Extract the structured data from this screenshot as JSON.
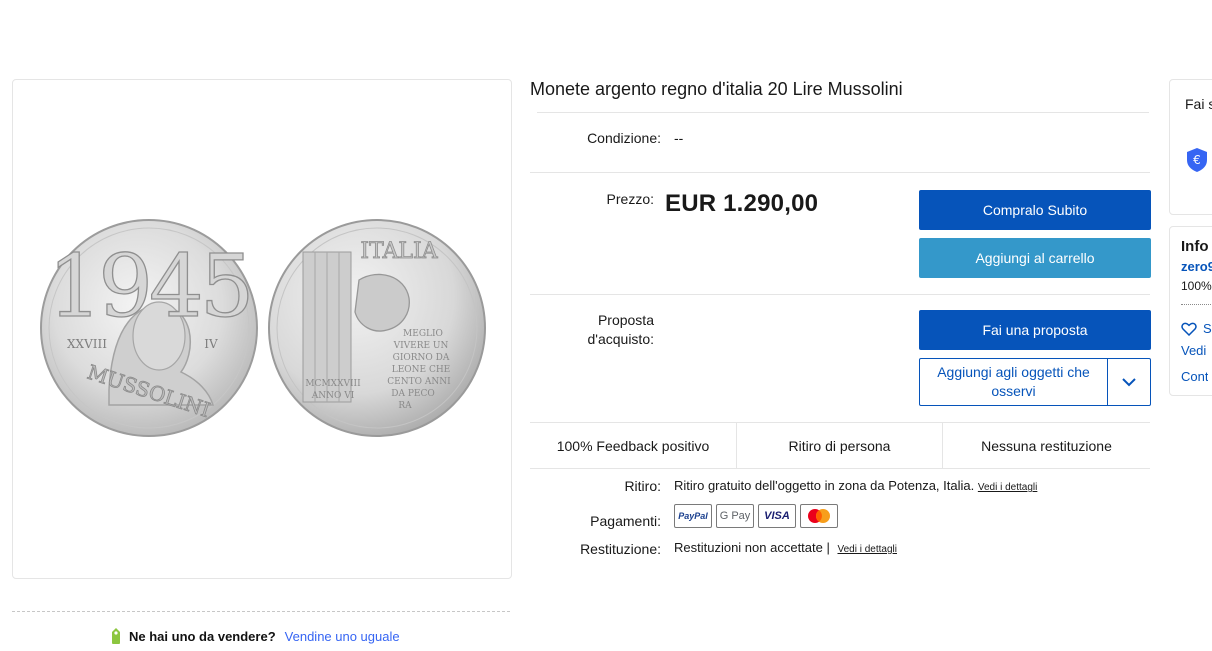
{
  "listing": {
    "title": "Monete argento regno d'italia 20 Lire Mussolini",
    "condition_label": "Condizione:",
    "condition_value": "--",
    "price_label": "Prezzo:",
    "price": "EUR 1.290,00",
    "offer_label": "Proposta d'acquisto:"
  },
  "buttons": {
    "buy_now": "Compralo Subito",
    "add_to_cart": "Aggiungi al carrello",
    "make_offer": "Fai una proposta",
    "watch": "Aggiungi agli oggetti che osservi"
  },
  "features": {
    "feedback": "100% Feedback positivo",
    "pickup": "Ritiro di persona",
    "returns": "Nessuna restituzione"
  },
  "details": {
    "pickup_label": "Ritiro:",
    "pickup_text": "Ritiro gratuito dell'oggetto in zona da Potenza, Italia.",
    "pickup_link": "Vedi i dettagli",
    "payments_label": "Pagamenti:",
    "payment_methods": [
      "PayPal",
      "G Pay",
      "VISA",
      "mastercard"
    ],
    "returns_label": "Restituzione:",
    "returns_text": "Restituzioni non accettate |",
    "returns_link": "Vedi i dettagli"
  },
  "sell": {
    "question": "Ne hai uno da vendere?",
    "link": "Vendine uno uguale"
  },
  "coin_front": {
    "year": "1945",
    "roman": "XXVIII",
    "roman2": "IV",
    "name": "MUSSOLINI"
  },
  "coin_back": {
    "legend": "ITALIA",
    "motto": [
      "MEGLIO",
      "VIVERE UN",
      "GIORNO DA",
      "LEONE CHE",
      "CENTO ANNI",
      "DA PECO",
      "RA"
    ],
    "roman": "MCMXXVIII",
    "roman2": "ANNO VI"
  },
  "side": {
    "card1_title": "Fai s",
    "card2_title": "Info",
    "seller": "zero9",
    "percent": "100%",
    "save": "S",
    "see": "Vedi",
    "contact": "Cont"
  },
  "colors": {
    "primary": "#0654ba",
    "secondary": "#3498ca",
    "link": "#3665f3"
  }
}
